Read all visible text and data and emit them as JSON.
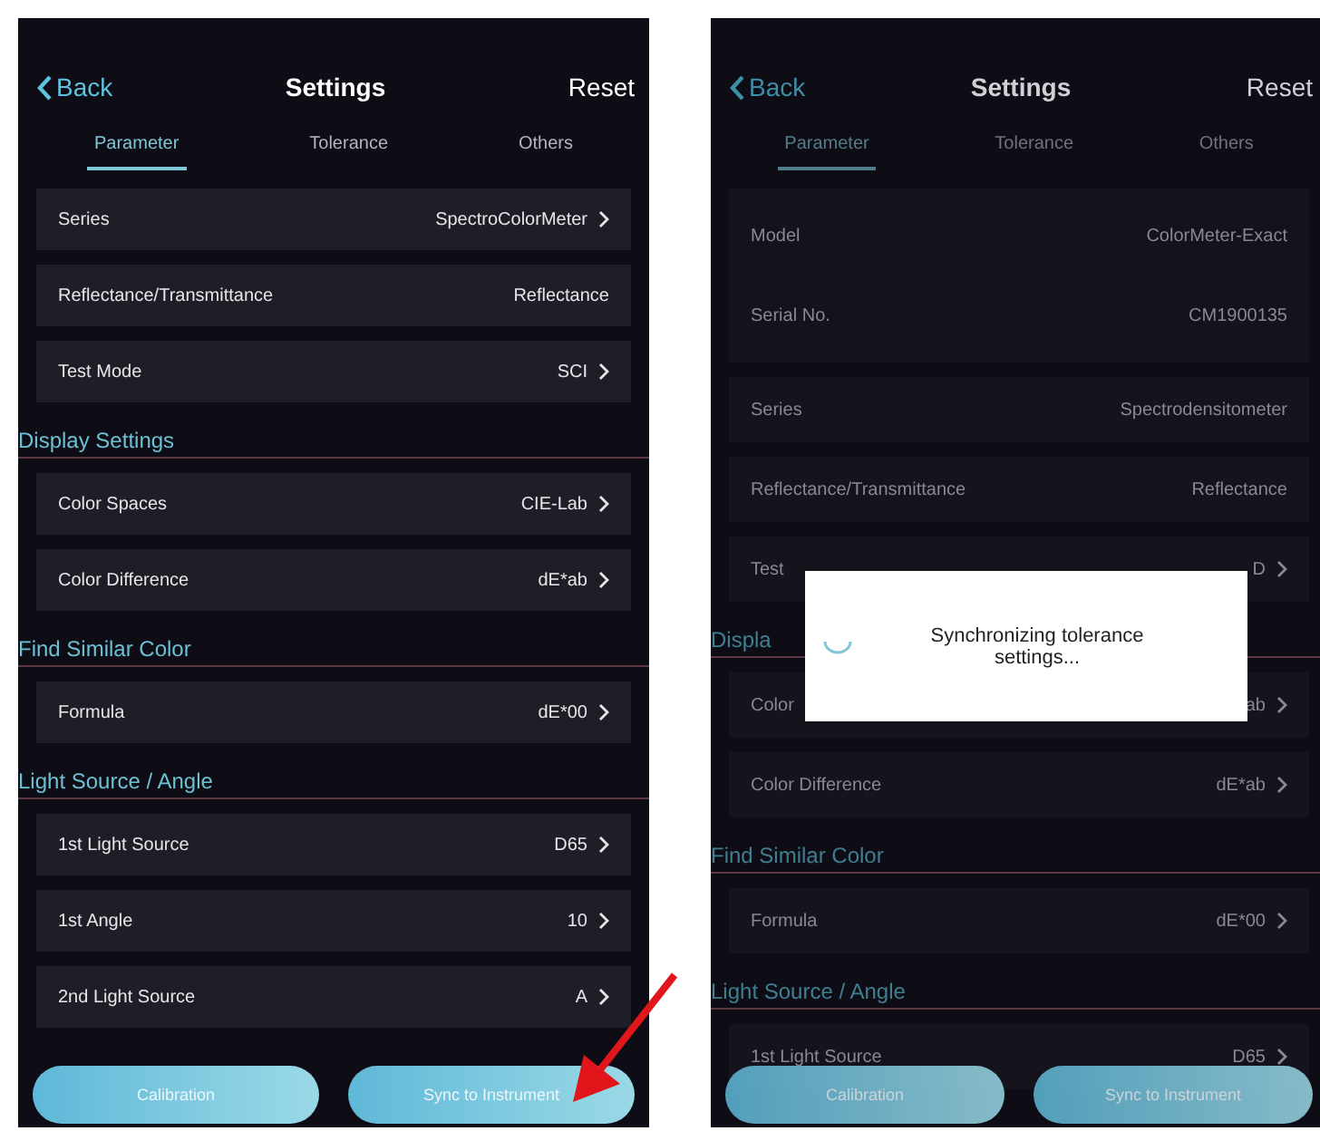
{
  "phones": [
    {
      "dimmed": false,
      "header": {
        "back": "Back",
        "title": "Settings",
        "action": "Reset"
      },
      "tabs": [
        {
          "label": "Parameter",
          "selected": true
        },
        {
          "label": "Tolerance",
          "selected": false
        },
        {
          "label": "Others",
          "selected": false
        }
      ],
      "items": [
        {
          "kind": "row",
          "label": "Series",
          "value": "SpectroColorMeter",
          "chevron": true
        },
        {
          "kind": "row",
          "label": "Reflectance/Transmittance",
          "value": "Reflectance",
          "chevron": false
        },
        {
          "kind": "row",
          "label": "Test Mode",
          "value": "SCI",
          "chevron": true
        },
        {
          "kind": "heading",
          "text": "Display Settings"
        },
        {
          "kind": "row",
          "label": "Color Spaces",
          "value": "CIE-Lab",
          "chevron": true
        },
        {
          "kind": "row",
          "label": "Color Difference",
          "value": "dE*ab",
          "chevron": true
        },
        {
          "kind": "heading",
          "text": "Find Similar Color"
        },
        {
          "kind": "row",
          "label": "Formula",
          "value": "dE*00",
          "chevron": true
        },
        {
          "kind": "heading",
          "text": "Light Source / Angle"
        },
        {
          "kind": "row",
          "label": "1st Light Source",
          "value": "D65",
          "chevron": true
        },
        {
          "kind": "row",
          "label": "1st Angle",
          "value": "10",
          "chevron": true
        },
        {
          "kind": "row",
          "label": "2nd Light Source",
          "value": "A",
          "chevron": true
        }
      ],
      "buttons": [
        "Calibration",
        "Sync to Instrument"
      ]
    },
    {
      "dimmed": true,
      "header": {
        "back": "Back",
        "title": "Settings",
        "action": "Reset"
      },
      "tabs": [
        {
          "label": "Parameter",
          "selected": true
        },
        {
          "label": "Tolerance",
          "selected": false
        },
        {
          "label": "Others",
          "selected": false
        }
      ],
      "items": [
        {
          "kind": "group",
          "rows": [
            {
              "label": "Model",
              "value": "ColorMeter-Exact"
            },
            {
              "label": "Serial No.",
              "value": "CM1900135"
            }
          ]
        },
        {
          "kind": "row",
          "label": "Series",
          "value": "Spectrodensitometer",
          "chevron": false
        },
        {
          "kind": "row",
          "label": "Reflectance/Transmittance",
          "value": "Reflectance",
          "chevron": false
        },
        {
          "kind": "row",
          "label": "Test",
          "value": "D",
          "chevron": true
        },
        {
          "kind": "heading",
          "text": "Displa"
        },
        {
          "kind": "row",
          "label": "Color",
          "value": "ab",
          "chevron": true
        },
        {
          "kind": "row",
          "label": "Color Difference",
          "value": "dE*ab",
          "chevron": true
        },
        {
          "kind": "heading",
          "text": "Find Similar Color"
        },
        {
          "kind": "row",
          "label": "Formula",
          "value": "dE*00",
          "chevron": true
        },
        {
          "kind": "heading",
          "text": "Light Source / Angle"
        },
        {
          "kind": "row",
          "label": "1st Light Source",
          "value": "D65",
          "chevron": true
        }
      ],
      "buttons": [
        "Calibration",
        "Sync to Instrument"
      ],
      "dialog": {
        "message": "Synchronizing tolerance settings..."
      }
    }
  ]
}
